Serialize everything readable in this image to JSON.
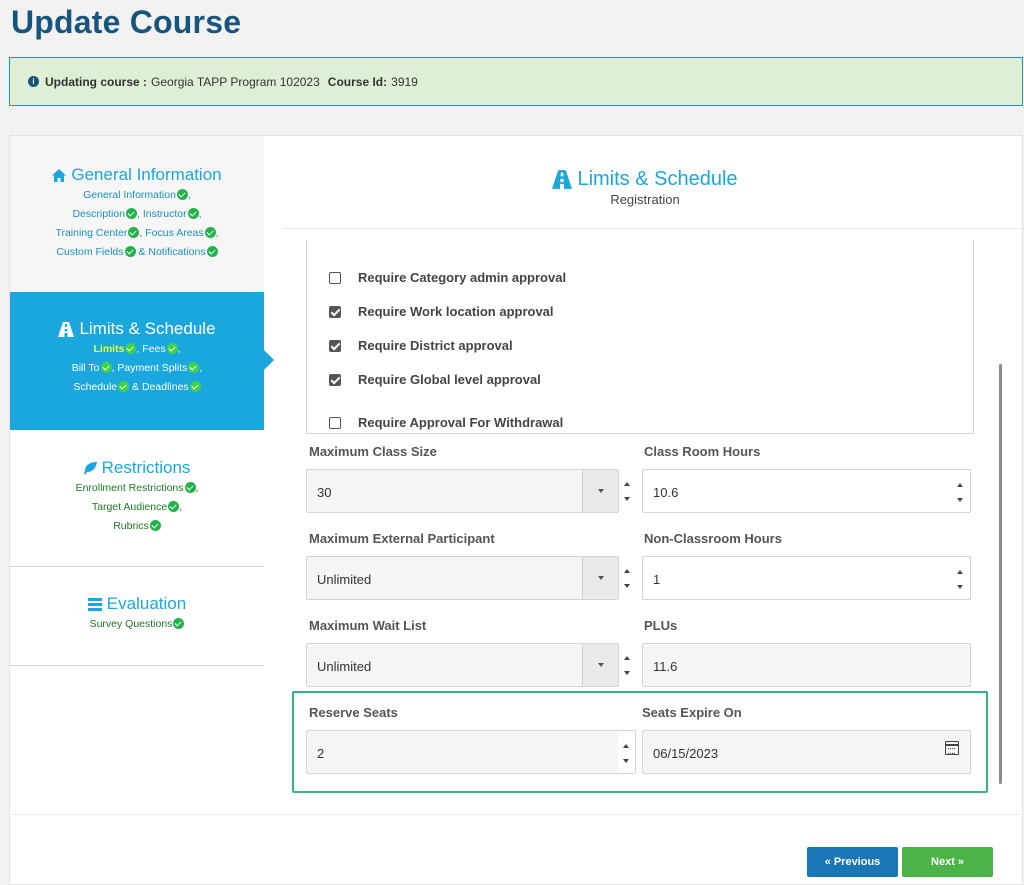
{
  "page": {
    "title": "Update Course"
  },
  "banner": {
    "updating_label": "Updating course :",
    "course_name": "Georgia TAPP Program 102023",
    "course_id_label": "Course Id:",
    "course_id": "3919"
  },
  "sidebar": {
    "general": {
      "title": "General Information",
      "items": [
        "General Information",
        "Description",
        "Instructor",
        "Training Center",
        "Focus Areas",
        "Custom Fields",
        "& Notifications"
      ]
    },
    "limits": {
      "title": "Limits & Schedule",
      "items": [
        "Limits",
        "Fees",
        "Bill To",
        "Payment Splits",
        "Schedule",
        "& Deadlines"
      ]
    },
    "restrictions": {
      "title": "Restrictions",
      "items": [
        "Enrollment Restrictions",
        "Target Audience",
        "Rubrics"
      ]
    },
    "evaluation": {
      "title": "Evaluation",
      "items": [
        "Survey Questions"
      ]
    }
  },
  "panel": {
    "title": "Limits & Schedule",
    "subtitle": "Registration"
  },
  "approvals": [
    {
      "label": "Require Category admin approval",
      "checked": false
    },
    {
      "label": "Require Work location approval",
      "checked": true
    },
    {
      "label": "Require District approval",
      "checked": true
    },
    {
      "label": "Require Global level approval",
      "checked": true
    },
    {
      "label": "Require Approval For Withdrawal",
      "checked": false
    }
  ],
  "fields": {
    "max_class_size": {
      "label": "Maximum Class Size",
      "value": "30"
    },
    "class_room_hours": {
      "label": "Class Room Hours",
      "value": "10.6"
    },
    "max_external": {
      "label": "Maximum External Participant",
      "value": "Unlimited"
    },
    "non_classroom_hours": {
      "label": "Non-Classroom Hours",
      "value": "1"
    },
    "max_wait_list": {
      "label": "Maximum Wait List",
      "value": "Unlimited"
    },
    "plus": {
      "label": "PLUs",
      "value": "11.6"
    },
    "reserve_seats": {
      "label": "Reserve Seats",
      "value": "2"
    },
    "seats_expire": {
      "label": "Seats Expire On",
      "value": "06/15/2023"
    }
  },
  "buttons": {
    "previous": "Previous",
    "next": "Next"
  },
  "icons": {
    "info": "info-circle-icon",
    "home": "home-icon",
    "road": "road-icon",
    "leaf": "leaf-icon",
    "list": "list-icon",
    "check": "check-circle-icon",
    "calendar": "calendar-icon"
  },
  "colors": {
    "accent": "#1aa7dd",
    "title": "#17557f",
    "success": "#22b24c",
    "banner_bg": "#deefd6"
  }
}
